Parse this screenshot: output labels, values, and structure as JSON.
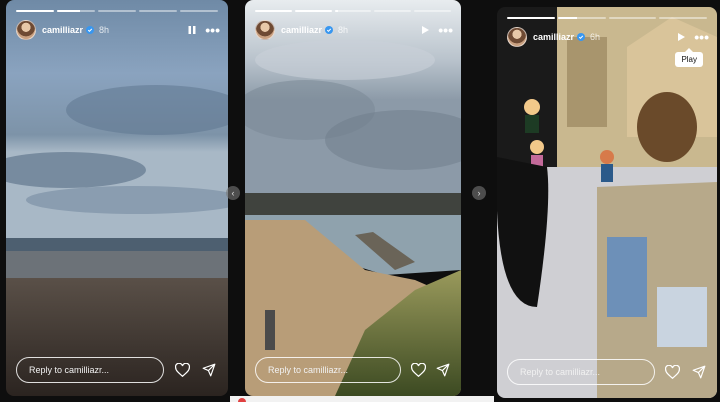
{
  "stories": [
    {
      "username": "camilliazr",
      "time": "8h",
      "control": "pause",
      "reply_placeholder": "Reply to camilliazr...",
      "progress": [
        1,
        0.6,
        0,
        0,
        0
      ]
    },
    {
      "username": "camilliazr",
      "time": "8h",
      "control": "play",
      "reply_placeholder": "Reply to camilliazr...",
      "progress": [
        1,
        1,
        0.1,
        0,
        0
      ]
    },
    {
      "username": "camilliazr",
      "time": "6h",
      "control": "play",
      "tooltip": "Play",
      "reply_placeholder": "Reply to camilliazr...",
      "progress": [
        1,
        0.4,
        0,
        0
      ]
    }
  ],
  "icons": {
    "verified": "verified-badge-icon",
    "pause": "pause-icon",
    "play": "play-icon",
    "more": "more-options-icon",
    "like": "heart-icon",
    "share": "send-icon"
  },
  "colors": {
    "background": "#0e0e0e",
    "verified": "#3897f0"
  }
}
